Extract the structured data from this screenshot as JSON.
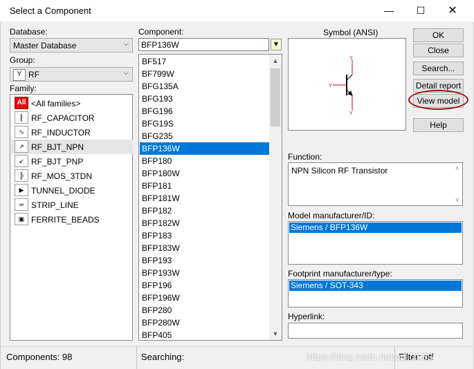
{
  "window": {
    "title": "Select a Component"
  },
  "database": {
    "label": "Database:",
    "value": "Master Database"
  },
  "group": {
    "label": "Group:",
    "value": "RF"
  },
  "family": {
    "label": "Family:",
    "items": [
      {
        "icon": "All",
        "label": "<All families>"
      },
      {
        "icon": "capacitor",
        "label": "RF_CAPACITOR"
      },
      {
        "icon": "inductor",
        "label": "RF_INDUCTOR"
      },
      {
        "icon": "bjt-npn",
        "label": "RF_BJT_NPN"
      },
      {
        "icon": "bjt-pnp",
        "label": "RF_BJT_PNP"
      },
      {
        "icon": "mos",
        "label": "RF_MOS_3TDN"
      },
      {
        "icon": "tunnel-diode",
        "label": "TUNNEL_DIODE"
      },
      {
        "icon": "strip-line",
        "label": "STRIP_LINE"
      },
      {
        "icon": "ferrite",
        "label": "FERRITE_BEADS"
      }
    ],
    "selected": "RF_BJT_NPN"
  },
  "component": {
    "label": "Component:",
    "value": "BFP136W",
    "items": [
      "BF517",
      "BF799W",
      "BFG135A",
      "BFG193",
      "BFG196",
      "BFG19S",
      "BFG235",
      "BFP136W",
      "BFP180",
      "BFP180W",
      "BFP181",
      "BFP181W",
      "BFP182",
      "BFP182W",
      "BFP183",
      "BFP183W",
      "BFP193",
      "BFP193W",
      "BFP196",
      "BFP196W",
      "BFP280",
      "BFP280W",
      "BFP405"
    ],
    "selected": "BFP136W"
  },
  "symbol": {
    "label": "Symbol (ANSI)"
  },
  "buttons": {
    "ok": "OK",
    "close": "Close",
    "search": "Search...",
    "detail": "Detail report",
    "view_model": "View model",
    "help": "Help"
  },
  "function": {
    "label": "Function:",
    "value": "NPN Silicon RF Transistor"
  },
  "model": {
    "label": "Model manufacturer/ID:",
    "value": "Siemens / BFP136W"
  },
  "footprint": {
    "label": "Footprint manufacturer/type:",
    "value": "Siemens / SOT-343"
  },
  "hyperlink": {
    "label": "Hyperlink:",
    "value": ""
  },
  "status": {
    "components": "Components: 98",
    "searching": "Searching:",
    "filter": "Filter: off",
    "watermark": "https://blog.csdn.net/qq_1983"
  },
  "colors": {
    "selection": "#0078d7",
    "highlight_ring": "#a01010",
    "all_icon": "#e01010"
  }
}
